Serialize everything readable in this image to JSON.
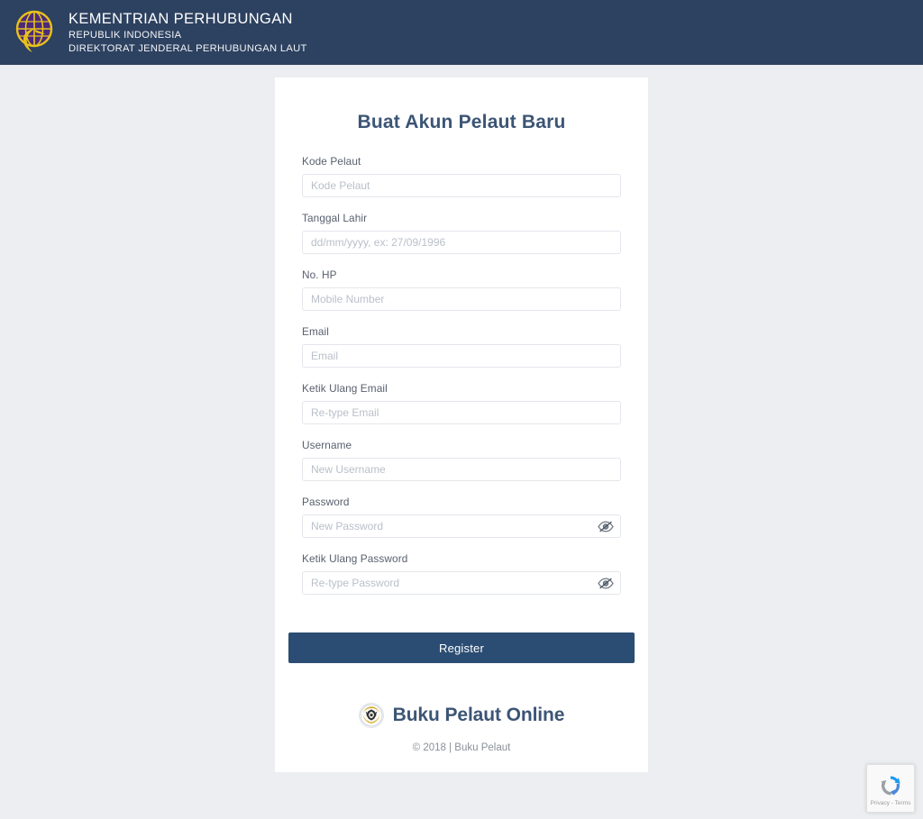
{
  "header": {
    "logo_icon": "kemenhub-globe-logo",
    "line1": "KEMENTRIAN PERHUBUNGAN",
    "line2": "REPUBLIK INDONESIA",
    "line3": "DIREKTORAT JENDERAL PERHUBUNGAN LAUT",
    "background_color": "#2d4160",
    "text_color": "#ffffff"
  },
  "card": {
    "title": "Buat Akun Pelaut Baru",
    "title_color": "#3c5575",
    "background_color": "#ffffff"
  },
  "form": {
    "fields": [
      {
        "label": "Kode Pelaut",
        "placeholder": "Kode Pelaut",
        "value": "",
        "type": "text"
      },
      {
        "label": "Tanggal Lahir",
        "placeholder": "dd/mm/yyyy, ex: 27/09/1996",
        "value": "",
        "type": "text"
      },
      {
        "label": "No. HP",
        "placeholder": "Mobile Number",
        "value": "",
        "type": "tel"
      },
      {
        "label": "Email",
        "placeholder": "Email",
        "value": "",
        "type": "email"
      },
      {
        "label": "Ketik Ulang Email",
        "placeholder": "Re-type Email",
        "value": "",
        "type": "email"
      },
      {
        "label": "Username",
        "placeholder": "New Username",
        "value": "",
        "type": "text"
      },
      {
        "label": "Password",
        "placeholder": "New Password",
        "value": "",
        "type": "password",
        "toggle_icon": "eye-slash-icon"
      },
      {
        "label": "Ketik Ulang Password",
        "placeholder": "Re-type Password",
        "value": "",
        "type": "password",
        "toggle_icon": "eye-slash-icon"
      }
    ],
    "submit_label": "Register",
    "submit_color": "#2b4d73"
  },
  "footer": {
    "emblem_icon": "garuda-emblem-icon",
    "brand": "Buku Pelaut Online",
    "brand_color": "#3c5575",
    "copyright": "© 2018 | Buku Pelaut"
  },
  "recaptcha": {
    "logo_icon": "recaptcha-logo-icon",
    "links": "Privacy - Terms"
  },
  "page": {
    "background_color": "#eceef2"
  }
}
